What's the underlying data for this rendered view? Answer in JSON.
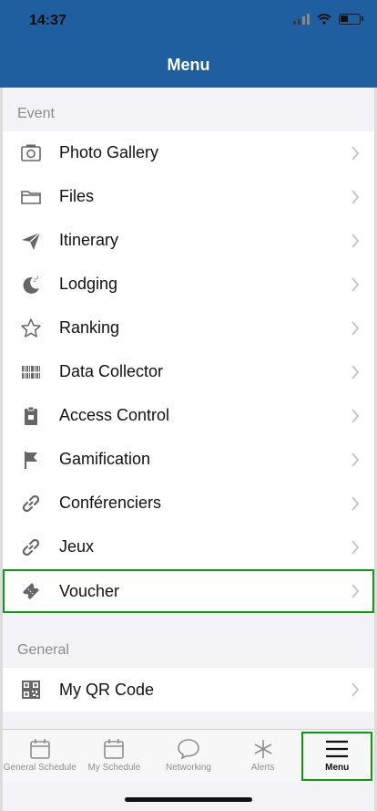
{
  "status_bar": {
    "time": "14:37"
  },
  "header": {
    "title": "Menu"
  },
  "sections": [
    {
      "title": "Event",
      "items": [
        {
          "label": "Photo Gallery",
          "icon": "camera-icon"
        },
        {
          "label": "Files",
          "icon": "folder-icon"
        },
        {
          "label": "Itinerary",
          "icon": "paper-plane-icon"
        },
        {
          "label": "Lodging",
          "icon": "moon-sleep-icon"
        },
        {
          "label": "Ranking",
          "icon": "star-icon"
        },
        {
          "label": "Data Collector",
          "icon": "barcode-icon"
        },
        {
          "label": "Access Control",
          "icon": "clipboard-icon"
        },
        {
          "label": "Gamification",
          "icon": "flag-icon"
        },
        {
          "label": "Conférenciers",
          "icon": "link-icon"
        },
        {
          "label": "Jeux",
          "icon": "link-icon"
        },
        {
          "label": "Voucher",
          "icon": "ticket-icon"
        }
      ]
    },
    {
      "title": "General",
      "items": [
        {
          "label": "My QR Code",
          "icon": "qr-code-icon"
        }
      ]
    }
  ],
  "tab_bar": {
    "tabs": [
      {
        "label": "General Schedule",
        "icon": "calendar-icon"
      },
      {
        "label": "My Schedule",
        "icon": "calendar-icon"
      },
      {
        "label": "Networking",
        "icon": "chat-bubble-icon"
      },
      {
        "label": "Alerts",
        "icon": "asterisk-icon"
      },
      {
        "label": "Menu",
        "icon": "hamburger-menu-icon",
        "active": true
      }
    ]
  },
  "colors": {
    "header": "#1f5fa0",
    "highlight": "#0c9b0c"
  }
}
